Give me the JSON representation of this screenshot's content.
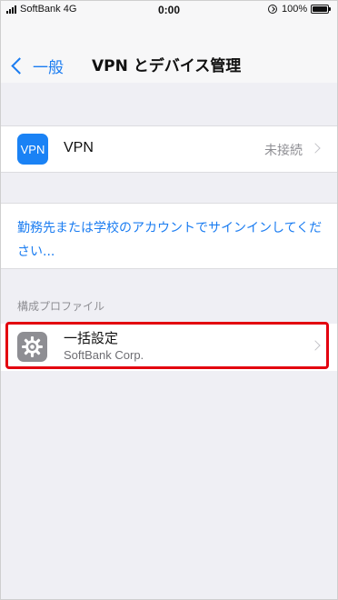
{
  "status_bar": {
    "carrier": "SoftBank  4G",
    "time": "0:00",
    "battery": "100%"
  },
  "nav": {
    "back_label": "一般",
    "title": "VPN とデバイス管理"
  },
  "vpn": {
    "icon_text": "VPN",
    "label": "VPN",
    "status": "未接続"
  },
  "signin": {
    "link_text": "勤務先または学校のアカウントでサインインしてください..."
  },
  "profiles": {
    "section_header": "構成プロファイル",
    "items": [
      {
        "title": "一括設定",
        "organization": "SoftBank Corp.",
        "icon": "gear-icon"
      }
    ]
  },
  "colors": {
    "accent": "#1a7cf1",
    "highlight": "#e3000f",
    "background": "#efeff4"
  }
}
